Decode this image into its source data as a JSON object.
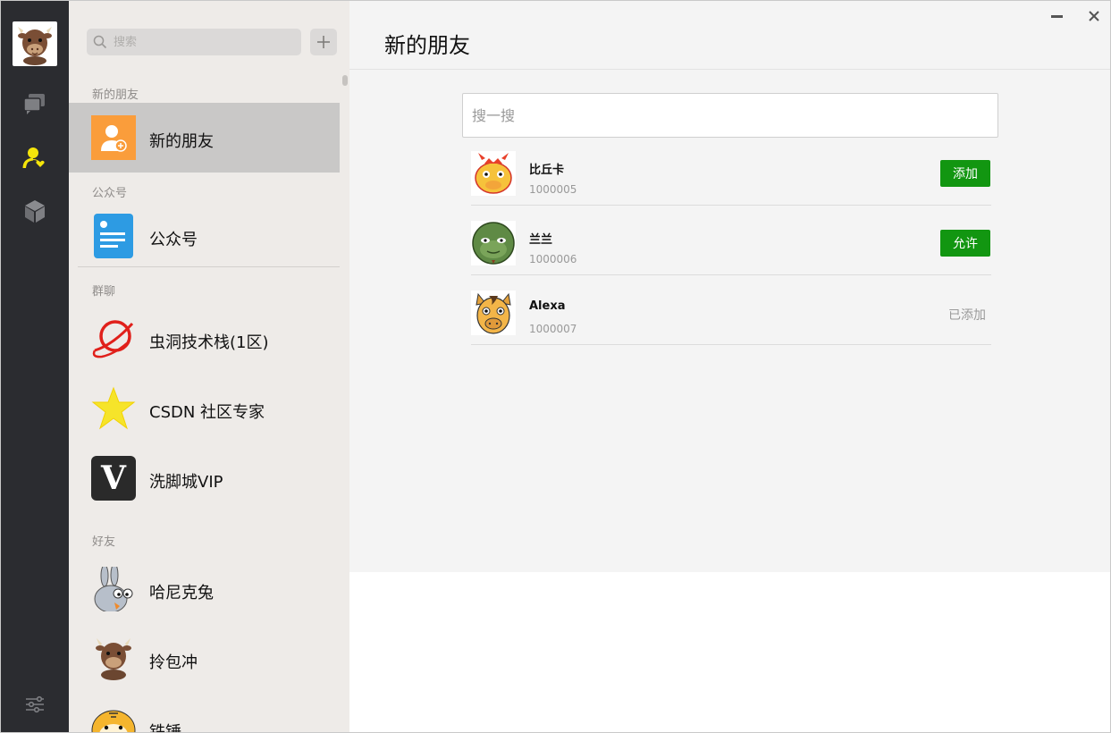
{
  "sidebar": {
    "search_placeholder": "搜索",
    "sections": {
      "new_friends": "新的朋友",
      "official": "公众号",
      "groups": "群聊",
      "friends": "好友"
    },
    "new_friends_item": "新的朋友",
    "official_item": "公众号",
    "groups": [
      {
        "name": "虫洞技术栈(1区)"
      },
      {
        "name": "CSDN 社区专家"
      },
      {
        "name": "洗脚城VIP",
        "logo_letter": "V"
      }
    ],
    "friends": [
      {
        "name": "哈尼克兔"
      },
      {
        "name": "拎包冲"
      },
      {
        "name": "铁锤"
      }
    ]
  },
  "main": {
    "title": "新的朋友",
    "search_placeholder": "搜一搜",
    "requests": [
      {
        "name": "比丘卡",
        "id": "1000005",
        "action": "添加",
        "state": "button"
      },
      {
        "name": "兰兰",
        "id": "1000006",
        "action": "允许",
        "state": "button"
      },
      {
        "name": "Alexa",
        "id": "1000007",
        "action": "已添加",
        "state": "text"
      }
    ]
  },
  "colors": {
    "accent_green": "#129611",
    "rail_bg": "#2b2c30",
    "active_nav": "#f5e50a",
    "list_bg": "#eeebe8"
  },
  "icons": [
    "search-icon",
    "plus-icon",
    "chat-icon",
    "contacts-icon",
    "cube-icon",
    "settings-icon",
    "minimize-icon",
    "close-icon"
  ]
}
